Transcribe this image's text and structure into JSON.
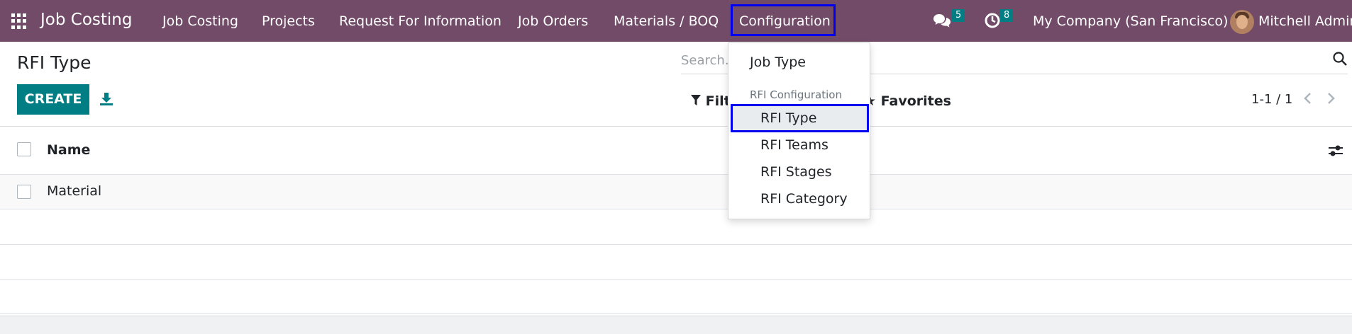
{
  "navbar": {
    "brand": "Job Costing",
    "menus": [
      "Job Costing",
      "Projects",
      "Request For Information",
      "Job Orders",
      "Materials / BOQ",
      "Configuration"
    ],
    "messages_count": "5",
    "activities_count": "8",
    "company": "My Company (San Francisco)",
    "user": "Mitchell Admin",
    "background_color": "#714b67"
  },
  "page": {
    "title": "RFI Type",
    "create_label": "CREATE"
  },
  "search": {
    "placeholder": "Search...",
    "filters_label": "Filters",
    "favorites_label": "Favorites"
  },
  "pager": {
    "label": "1-1 / 1"
  },
  "list": {
    "columns": [
      "Name"
    ],
    "rows": [
      "Material"
    ]
  },
  "dropdown": {
    "items_top": [
      "Job Type"
    ],
    "section_header": "RFI Configuration",
    "section_items": [
      "RFI Type",
      "RFI Teams",
      "RFI Stages",
      "RFI Category"
    ],
    "active_item": "RFI Type"
  },
  "colors": {
    "accent": "#017e84",
    "highlight_border": "#0000ee"
  }
}
